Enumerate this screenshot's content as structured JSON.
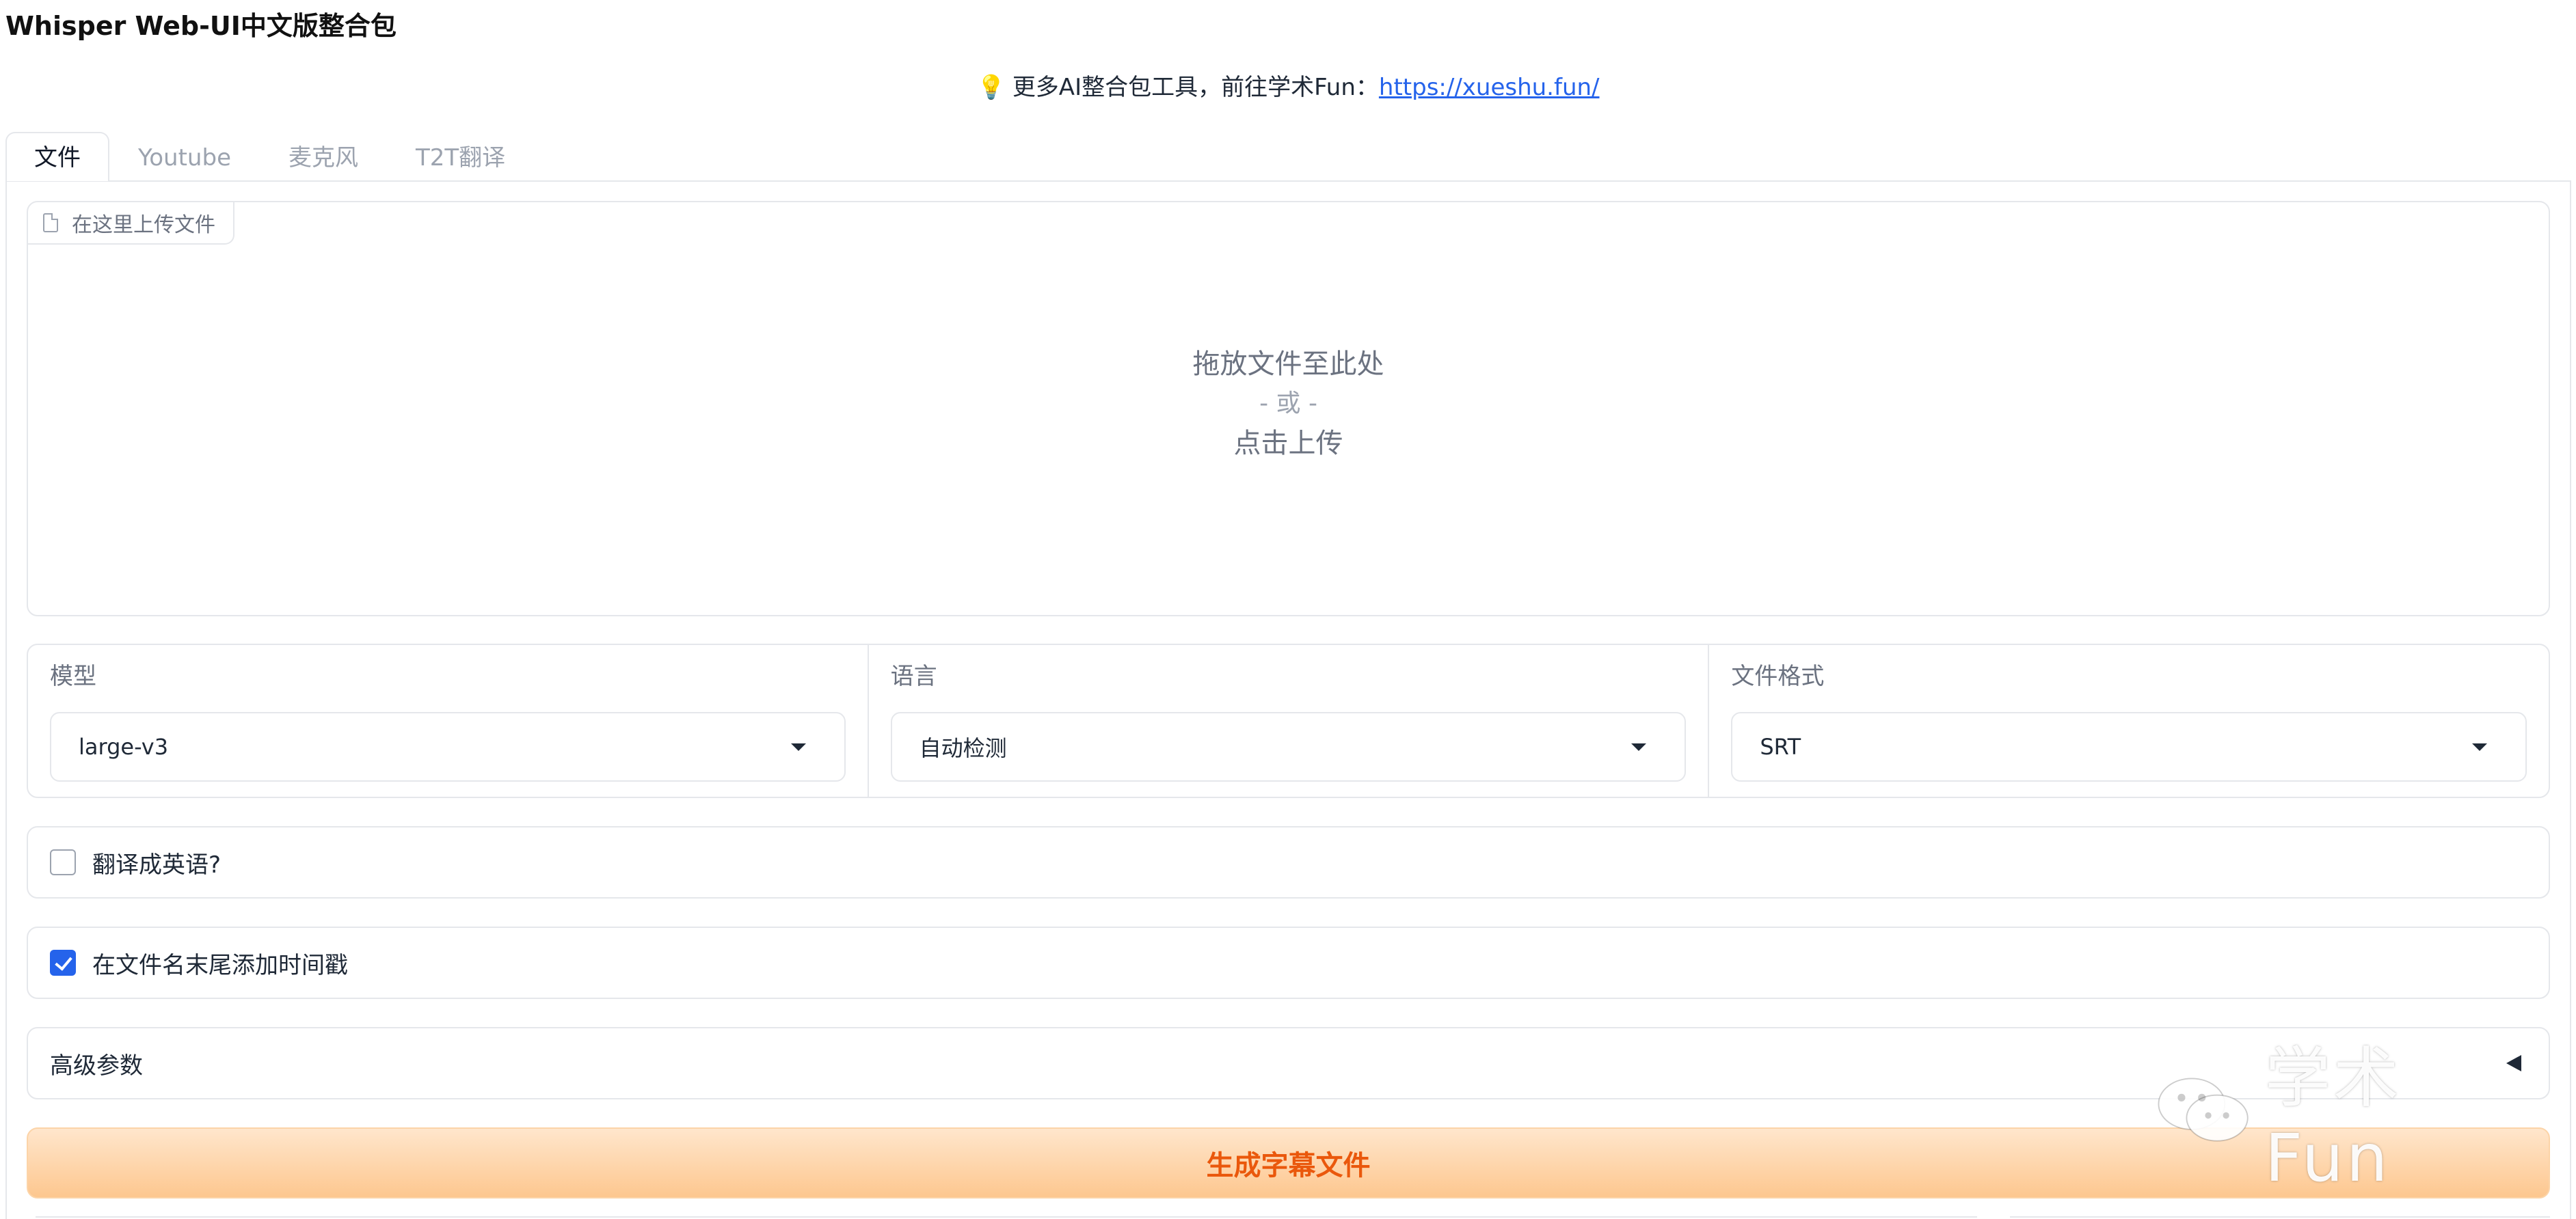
{
  "app": {
    "title": "Whisper Web-UI中文版整合包"
  },
  "promo": {
    "icon": "lightbulb-icon",
    "text": "更多AI整合包工具，前往学术Fun：",
    "link_text": "https://xueshu.fun/"
  },
  "tabs": [
    {
      "label": "文件",
      "active": true
    },
    {
      "label": "Youtube",
      "active": false
    },
    {
      "label": "麦克风",
      "active": false
    },
    {
      "label": "T2T翻译",
      "active": false
    }
  ],
  "upload": {
    "label": "在这里上传文件",
    "drop_line1": "拖放文件至此处",
    "drop_line2": "- 或 -",
    "drop_line3": "点击上传"
  },
  "settings": {
    "model": {
      "label": "模型",
      "value": "large-v3"
    },
    "language": {
      "label": "语言",
      "value": "自动检测"
    },
    "format": {
      "label": "文件格式",
      "value": "SRT"
    }
  },
  "options": {
    "translate": {
      "label": "翻译成英语?",
      "checked": false
    },
    "timestamp": {
      "label": "在文件名末尾添加时间戳",
      "checked": true
    }
  },
  "advanced": {
    "label": "高级参数"
  },
  "generate_button": {
    "label": "生成字幕文件"
  },
  "watermark": {
    "text": "学术Fun"
  },
  "colors": {
    "accent": "#2563eb",
    "button_text": "#ea580c",
    "button_bg_top": "#ffe6cc",
    "button_bg_bottom": "#fdc78f"
  }
}
